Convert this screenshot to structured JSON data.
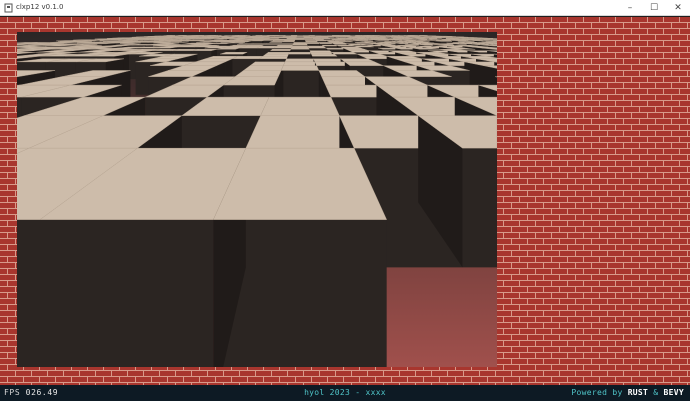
{
  "window": {
    "title": "clxp12 v0.1.0",
    "controls": {
      "minimize": "–",
      "maximize": "☐",
      "close": "✕"
    }
  },
  "hud": {
    "fps_label": "FPS",
    "fps_value": "026.49",
    "credit": "hyol 2023 - xxxx",
    "powered_by": "Powered by",
    "brand_left": "RUST",
    "brand_amp": "&",
    "brand_right": "BEVY"
  },
  "colors": {
    "brick": "#a8362e",
    "mortar": "#d89a8a",
    "cube_top": "#cdbcaa",
    "cube_side": "#2b2522",
    "floor": "#8a3c38",
    "accent_cyan": "#4fc3c7"
  }
}
